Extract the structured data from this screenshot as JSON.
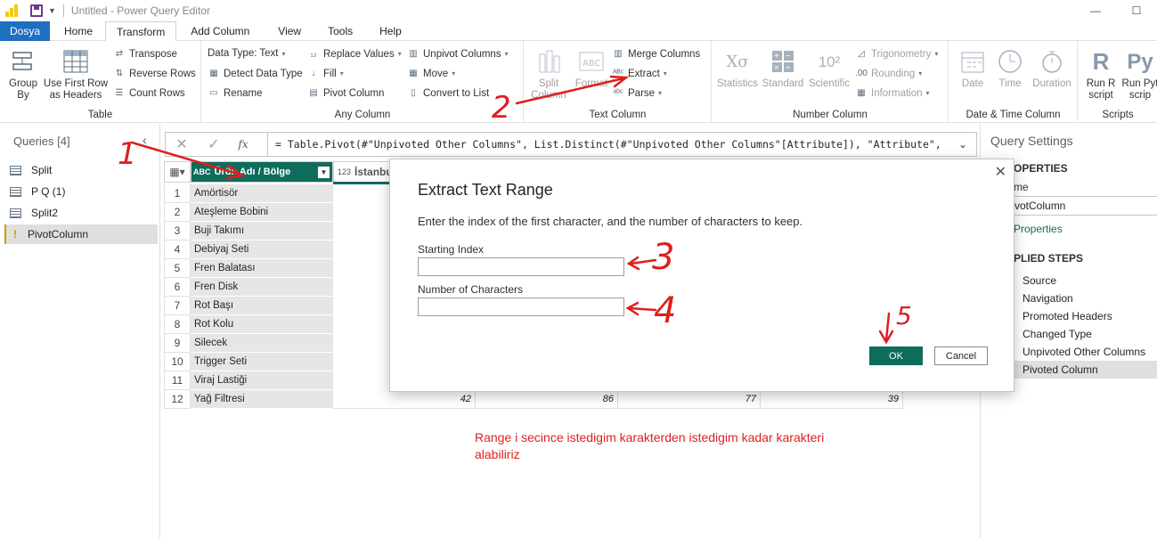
{
  "window": {
    "title": "Untitled - Power Query Editor"
  },
  "tabs": [
    "Dosya",
    "Home",
    "Transform",
    "Add Column",
    "View",
    "Tools",
    "Help"
  ],
  "ribbon": {
    "table": {
      "label": "Table",
      "group_by": "Group\nBy",
      "use_first_row": "Use First Row\nas Headers",
      "transpose": "Transpose",
      "reverse_rows": "Reverse Rows",
      "count_rows": "Count Rows"
    },
    "any_column": {
      "label": "Any Column",
      "data_type": "Data Type: Text",
      "detect_data_type": "Detect Data Type",
      "rename": "Rename",
      "replace_values": "Replace Values",
      "fill": "Fill",
      "pivot_column": "Pivot Column",
      "unpivot_columns": "Unpivot Columns",
      "move": "Move",
      "convert_to_list": "Convert to List"
    },
    "text_column": {
      "label": "Text Column",
      "split_column": "Split\nColumn",
      "format": "Format",
      "merge_columns": "Merge Columns",
      "extract": "Extract",
      "parse": "Parse"
    },
    "number_column": {
      "label": "Number Column",
      "statistics": "Statistics",
      "standard": "Standard",
      "scientific": "Scientific",
      "trigonometry": "Trigonometry",
      "rounding": "Rounding",
      "information": "Information"
    },
    "datetime_column": {
      "label": "Date & Time Column",
      "date": "Date",
      "time": "Time",
      "duration": "Duration"
    },
    "scripts": {
      "label": "Scripts",
      "run_r": "Run R\nscript",
      "run_python": "Run Pyt\nscrip"
    }
  },
  "queries": {
    "header": "Queries [4]",
    "items": [
      "Split",
      "P Q (1)",
      "Split2",
      "PivotColumn"
    ]
  },
  "formula": {
    "text": "= Table.Pivot(#\"Unpivoted Other Columns\", List.Distinct(#\"Unpivoted Other Columns\"[Attribute]), \"Attribute\","
  },
  "grid": {
    "col1_header": "Ürün Adı / Bölge",
    "col2_header": "İstanbul",
    "col1_type": "ABC",
    "col2_type": "123",
    "rows": [
      {
        "n": "1",
        "name": "Amörtisör"
      },
      {
        "n": "2",
        "name": "Ateşleme Bobini"
      },
      {
        "n": "3",
        "name": "Buji Takımı"
      },
      {
        "n": "4",
        "name": "Debiyaj Seti"
      },
      {
        "n": "5",
        "name": "Fren Balatası"
      },
      {
        "n": "6",
        "name": "Fren Disk"
      },
      {
        "n": "7",
        "name": "Rot Başı"
      },
      {
        "n": "8",
        "name": "Rot Kolu"
      },
      {
        "n": "9",
        "name": "Silecek"
      },
      {
        "n": "10",
        "name": "Trigger Seti"
      },
      {
        "n": "11",
        "name": "Viraj Lastiği"
      },
      {
        "n": "12",
        "name": "Yağ Filtresi"
      }
    ],
    "last_row_values": [
      "42",
      "86",
      "77",
      "39"
    ]
  },
  "note": "Range i secince istedigim karakterden istedigim kadar karakteri alabiliriz",
  "query_settings": {
    "title": "Query Settings",
    "properties": "OPERTIES",
    "name_label": "me",
    "name_value": "votColumn",
    "all_properties": "Properties",
    "applied_steps": "PLIED STEPS",
    "steps": [
      "Source",
      "Navigation",
      "Promoted Headers",
      "Changed Type",
      "Unpivoted Other Columns",
      "Pivoted Column"
    ]
  },
  "dialog": {
    "title": "Extract Text Range",
    "description": "Enter the index of the first character, and the number of characters to keep.",
    "starting_index_label": "Starting Index",
    "starting_index_value": "",
    "num_chars_label": "Number of Characters",
    "num_chars_value": "",
    "ok": "OK",
    "cancel": "Cancel"
  },
  "annotations": [
    "1",
    "2",
    "3",
    "4",
    "5"
  ],
  "colors": {
    "accent": "#0e6c5d",
    "file_tab": "#1f6fbf",
    "annotation": "#e01e1e"
  }
}
